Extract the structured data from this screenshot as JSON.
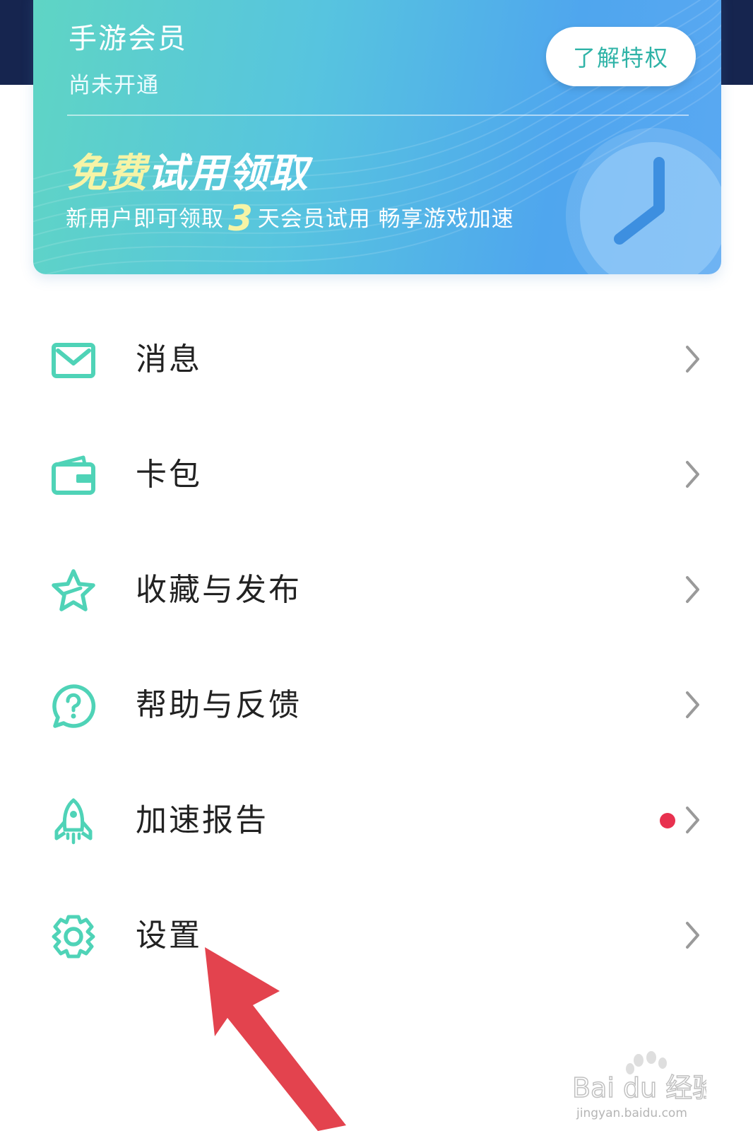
{
  "colors": {
    "accent": "#4fd3b7",
    "header_dark": "#16254f",
    "badge_red": "#e8314f",
    "annotation_arrow": "#e3434e"
  },
  "member_card": {
    "title": "手游会员",
    "status": "尚未开通",
    "learn_button": "了解特权",
    "promo_highlight": "免费",
    "promo_rest": "试用领取",
    "promo_sub_prefix": "新用户即可领取",
    "promo_days": "3",
    "promo_sub_suffix": "天会员试用 畅享游戏加速",
    "illustration_icon": "clock-icon"
  },
  "menu": [
    {
      "label": "消息",
      "icon": "mail-icon",
      "badge": false
    },
    {
      "label": "卡包",
      "icon": "wallet-icon",
      "badge": false
    },
    {
      "label": "收藏与发布",
      "icon": "star-icon",
      "badge": false
    },
    {
      "label": "帮助与反馈",
      "icon": "help-bubble-icon",
      "badge": false
    },
    {
      "label": "加速报告",
      "icon": "rocket-icon",
      "badge": true
    },
    {
      "label": "设置",
      "icon": "gear-icon",
      "badge": false
    }
  ],
  "watermark": {
    "brand": "Bai du 经验",
    "url": "jingyan.baidu.com"
  }
}
